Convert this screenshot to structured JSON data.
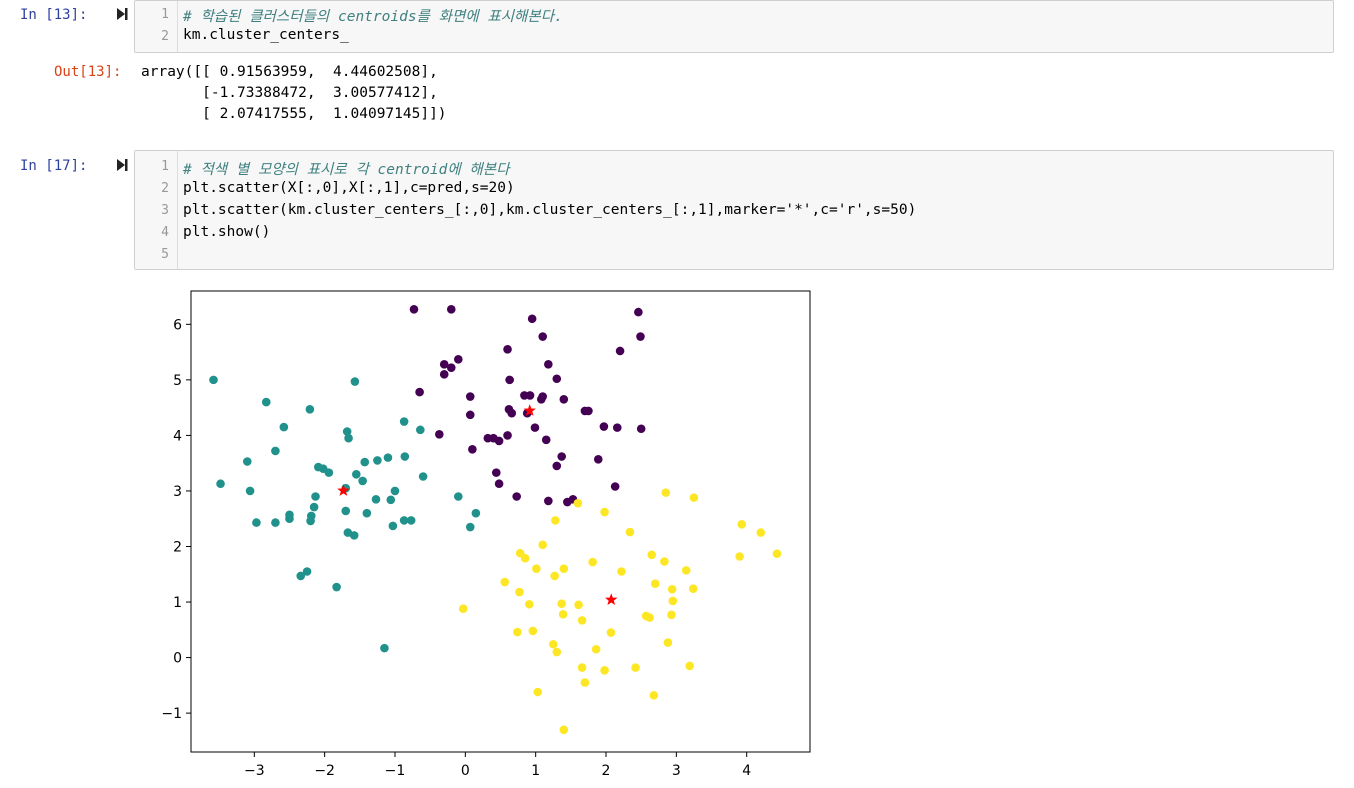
{
  "cells": [
    {
      "prompt": "In [13]:",
      "lines": [
        {
          "n": "1",
          "comment": "# 학습된 클러스터들의 centroids를 화면에 표시해본다."
        },
        {
          "n": "2",
          "code": "km.cluster_centers_"
        }
      ],
      "output_prompt": "Out[13]:",
      "output_lines": [
        "array([[ 0.91563959,  4.44602508],",
        "       [-1.73388472,  3.00577412],",
        "       [ 2.07417555,  1.04097145]])"
      ]
    },
    {
      "prompt": "In [17]:",
      "lines": [
        {
          "n": "1",
          "comment": "# 적색 별 모양의 표시로 각 centroid에 해본다"
        },
        {
          "n": "2",
          "code": "plt.scatter(X[:,0],X[:,1],c=pred,s=20)"
        },
        {
          "n": "3",
          "code": "plt.scatter(km.cluster_centers_[:,0],km.cluster_centers_[:,1],marker='*',c='r',s=50)"
        },
        {
          "n": "4",
          "code": "plt.show()"
        },
        {
          "n": "5",
          "code": ""
        }
      ]
    }
  ],
  "chart_data": {
    "type": "scatter",
    "xlim": [
      -3.9,
      4.9
    ],
    "ylim": [
      -1.7,
      6.6
    ],
    "xticks": [
      -3,
      -2,
      -1,
      0,
      1,
      2,
      3,
      4
    ],
    "yticks": [
      -1,
      0,
      1,
      2,
      3,
      4,
      5,
      6
    ],
    "xtick_labels": [
      "−3",
      "−2",
      "−1",
      "0",
      "1",
      "2",
      "3",
      "4"
    ],
    "ytick_labels": [
      "−1",
      "0",
      "1",
      "2",
      "3",
      "4",
      "5",
      "6"
    ],
    "grid": false,
    "colors": {
      "cluster0": "#440154",
      "cluster1": "#21918c",
      "cluster2": "#fde725",
      "centroid": "#ff0000"
    },
    "series": [
      {
        "cluster": 0,
        "points": [
          [
            -0.73,
            6.27
          ],
          [
            -0.2,
            6.27
          ],
          [
            0.95,
            6.1
          ],
          [
            2.46,
            6.22
          ],
          [
            1.1,
            5.78
          ],
          [
            2.49,
            5.78
          ],
          [
            0.6,
            5.55
          ],
          [
            2.2,
            5.52
          ],
          [
            -0.1,
            5.37
          ],
          [
            -0.3,
            5.28
          ],
          [
            1.18,
            5.28
          ],
          [
            -0.2,
            5.22
          ],
          [
            -0.3,
            5.1
          ],
          [
            0.63,
            5.0
          ],
          [
            1.3,
            5.02
          ],
          [
            -0.65,
            4.78
          ],
          [
            0.07,
            4.7
          ],
          [
            0.92,
            4.72
          ],
          [
            1.1,
            4.7
          ],
          [
            0.84,
            4.72
          ],
          [
            1.08,
            4.65
          ],
          [
            1.4,
            4.65
          ],
          [
            0.62,
            4.47
          ],
          [
            0.66,
            4.4
          ],
          [
            1.7,
            4.44
          ],
          [
            1.75,
            4.44
          ],
          [
            0.07,
            4.37
          ],
          [
            0.88,
            4.4
          ],
          [
            1.97,
            4.16
          ],
          [
            2.16,
            4.14
          ],
          [
            2.5,
            4.12
          ],
          [
            0.99,
            4.14
          ],
          [
            -0.37,
            4.02
          ],
          [
            0.32,
            3.95
          ],
          [
            0.4,
            3.95
          ],
          [
            0.48,
            3.9
          ],
          [
            0.6,
            4.0
          ],
          [
            1.15,
            3.92
          ],
          [
            0.1,
            3.75
          ],
          [
            1.37,
            3.62
          ],
          [
            1.89,
            3.57
          ],
          [
            1.3,
            3.45
          ],
          [
            0.44,
            3.33
          ],
          [
            0.48,
            3.13
          ],
          [
            2.13,
            3.08
          ],
          [
            0.73,
            2.9
          ],
          [
            1.18,
            2.82
          ],
          [
            1.45,
            2.8
          ],
          [
            1.53,
            2.85
          ]
        ]
      },
      {
        "cluster": 1,
        "points": [
          [
            -3.58,
            5.0
          ],
          [
            -1.57,
            4.97
          ],
          [
            -2.83,
            4.6
          ],
          [
            -2.21,
            4.47
          ],
          [
            -2.58,
            4.15
          ],
          [
            -1.68,
            4.07
          ],
          [
            -1.66,
            3.95
          ],
          [
            -0.87,
            4.25
          ],
          [
            -0.64,
            4.1
          ],
          [
            -2.7,
            3.72
          ],
          [
            -3.1,
            3.53
          ],
          [
            -2.09,
            3.43
          ],
          [
            -1.43,
            3.52
          ],
          [
            -1.25,
            3.55
          ],
          [
            -1.1,
            3.6
          ],
          [
            -0.86,
            3.62
          ],
          [
            -2.02,
            3.4
          ],
          [
            -1.94,
            3.33
          ],
          [
            -1.55,
            3.3
          ],
          [
            -1.46,
            3.18
          ],
          [
            -0.6,
            3.26
          ],
          [
            -3.48,
            3.13
          ],
          [
            -3.06,
            3.0
          ],
          [
            -2.13,
            2.9
          ],
          [
            -1.7,
            3.05
          ],
          [
            -1.0,
            3.0
          ],
          [
            -1.06,
            2.84
          ],
          [
            -1.27,
            2.85
          ],
          [
            -0.1,
            2.9
          ],
          [
            -2.15,
            2.71
          ],
          [
            -1.7,
            2.64
          ],
          [
            -1.4,
            2.6
          ],
          [
            -2.5,
            2.57
          ],
          [
            -2.19,
            2.55
          ],
          [
            -2.5,
            2.5
          ],
          [
            -2.2,
            2.46
          ],
          [
            -2.97,
            2.43
          ],
          [
            -2.7,
            2.43
          ],
          [
            -0.87,
            2.47
          ],
          [
            -0.77,
            2.47
          ],
          [
            -1.03,
            2.37
          ],
          [
            0.07,
            2.35
          ],
          [
            0.15,
            2.6
          ],
          [
            -1.67,
            2.25
          ],
          [
            -1.58,
            2.2
          ],
          [
            -2.34,
            1.47
          ],
          [
            -2.25,
            1.55
          ],
          [
            -1.83,
            1.27
          ],
          [
            -1.15,
            0.17
          ]
        ]
      },
      {
        "cluster": 2,
        "points": [
          [
            2.85,
            2.97
          ],
          [
            3.25,
            2.88
          ],
          [
            1.98,
            2.62
          ],
          [
            1.6,
            2.78
          ],
          [
            1.28,
            2.47
          ],
          [
            2.34,
            2.26
          ],
          [
            3.93,
            2.4
          ],
          [
            4.2,
            2.25
          ],
          [
            1.1,
            2.03
          ],
          [
            0.78,
            1.88
          ],
          [
            0.85,
            1.79
          ],
          [
            2.65,
            1.85
          ],
          [
            2.83,
            1.73
          ],
          [
            3.9,
            1.82
          ],
          [
            4.43,
            1.87
          ],
          [
            1.81,
            1.72
          ],
          [
            1.01,
            1.6
          ],
          [
            1.4,
            1.6
          ],
          [
            1.27,
            1.47
          ],
          [
            2.22,
            1.55
          ],
          [
            3.14,
            1.57
          ],
          [
            0.56,
            1.36
          ],
          [
            2.7,
            1.33
          ],
          [
            0.77,
            1.18
          ],
          [
            2.94,
            1.23
          ],
          [
            3.24,
            1.24
          ],
          [
            0.91,
            0.96
          ],
          [
            1.37,
            0.97
          ],
          [
            1.61,
            0.95
          ],
          [
            2.95,
            1.02
          ],
          [
            1.39,
            0.78
          ],
          [
            2.57,
            0.75
          ],
          [
            2.62,
            0.72
          ],
          [
            2.93,
            0.77
          ],
          [
            1.66,
            0.67
          ],
          [
            -0.03,
            0.88
          ],
          [
            0.96,
            0.48
          ],
          [
            0.74,
            0.46
          ],
          [
            2.07,
            0.45
          ],
          [
            1.25,
            0.24
          ],
          [
            1.3,
            0.1
          ],
          [
            2.88,
            0.27
          ],
          [
            1.86,
            0.15
          ],
          [
            1.66,
            -0.18
          ],
          [
            2.42,
            -0.18
          ],
          [
            3.19,
            -0.15
          ],
          [
            1.98,
            -0.23
          ],
          [
            1.7,
            -0.45
          ],
          [
            1.03,
            -0.62
          ],
          [
            2.68,
            -0.68
          ],
          [
            1.4,
            -1.3
          ]
        ]
      }
    ],
    "centroids": [
      [
        0.91563959,
        4.44602508
      ],
      [
        -1.73388472,
        3.00577412
      ],
      [
        2.07417555,
        1.04097145
      ]
    ]
  }
}
